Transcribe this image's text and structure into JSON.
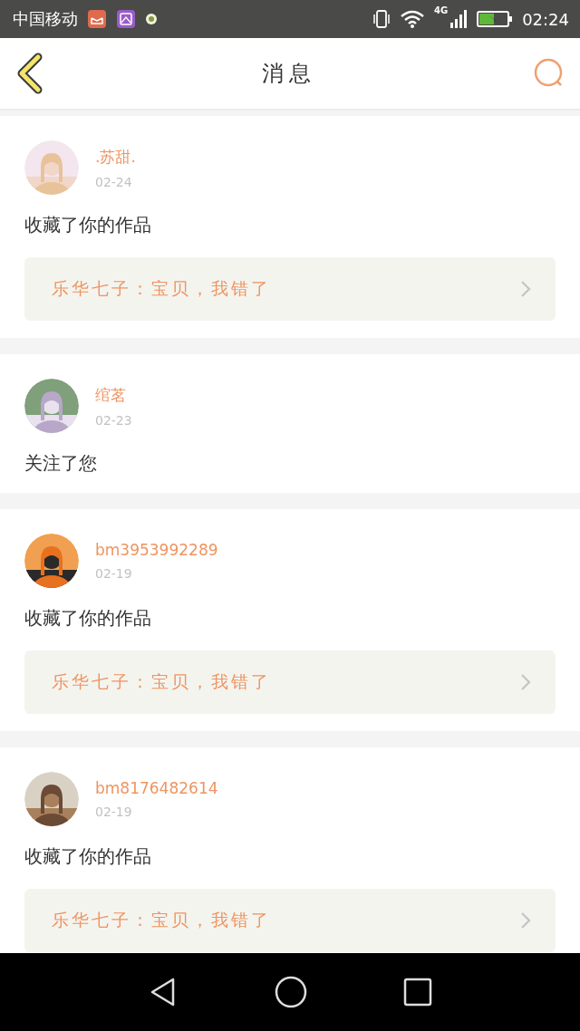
{
  "status_bar": {
    "carrier": "中国移动",
    "network": "4G",
    "time": "02:24"
  },
  "header": {
    "title": "消息"
  },
  "messages": [
    {
      "kind": "picture",
      "name": ".苏甜.",
      "date": "02-24",
      "action": "收藏了你的作品",
      "work": "乐华七子：宝贝，我错了"
    },
    {
      "kind": "picture",
      "name": "绾茗",
      "date": "02-23",
      "action": "关注了您"
    },
    {
      "kind": "picture",
      "name": "bm3953992289",
      "date": "02-19",
      "action": "收藏了你的作品",
      "work": "乐华七子：宝贝，我错了"
    },
    {
      "kind": "picture",
      "name": "bm8176482614",
      "date": "02-19",
      "action": "收藏了你的作品",
      "work": "乐华七子：宝贝，我错了"
    }
  ]
}
